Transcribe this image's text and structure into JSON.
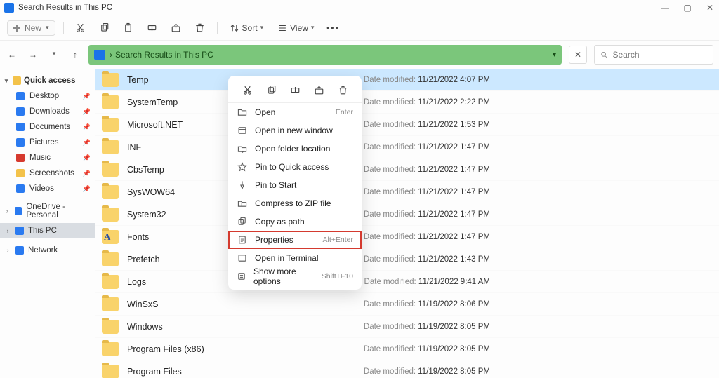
{
  "window": {
    "title": "Search Results in This PC"
  },
  "toolbar": {
    "new_label": "New",
    "sort_label": "Sort",
    "view_label": "View"
  },
  "addressbar": {
    "text": "Search Results in This PC"
  },
  "search": {
    "placeholder": "Search"
  },
  "sidebar": {
    "quick_access": "Quick access",
    "pinned": [
      {
        "label": "Desktop"
      },
      {
        "label": "Downloads"
      },
      {
        "label": "Documents"
      },
      {
        "label": "Pictures"
      },
      {
        "label": "Music"
      },
      {
        "label": "Screenshots"
      },
      {
        "label": "Videos"
      }
    ],
    "onedrive": "OneDrive - Personal",
    "this_pc": "This PC",
    "network": "Network"
  },
  "meta_label": "Date modified:",
  "results": [
    {
      "name": "Temp",
      "date": "11/21/2022 4:07 PM",
      "selected": true
    },
    {
      "name": "SystemTemp",
      "date": "11/21/2022 2:22 PM"
    },
    {
      "name": "Microsoft.NET",
      "date": "11/21/2022 1:53 PM"
    },
    {
      "name": "INF",
      "date": "11/21/2022 1:47 PM"
    },
    {
      "name": "CbsTemp",
      "date": "11/21/2022 1:47 PM"
    },
    {
      "name": "SysWOW64",
      "date": "11/21/2022 1:47 PM"
    },
    {
      "name": "System32",
      "date": "11/21/2022 1:47 PM"
    },
    {
      "name": "Fonts",
      "date": "11/21/2022 1:47 PM",
      "fonts": true
    },
    {
      "name": "Prefetch",
      "date": "11/21/2022 1:43 PM"
    },
    {
      "name": "Logs",
      "date": "11/21/2022 9:41 AM"
    },
    {
      "name": "WinSxS",
      "date": "11/19/2022 8:06 PM"
    },
    {
      "name": "Windows",
      "date": "11/19/2022 8:05 PM"
    },
    {
      "name": "Program Files (x86)",
      "date": "11/19/2022 8:05 PM"
    },
    {
      "name": "Program Files",
      "date": "11/19/2022 8:05 PM"
    }
  ],
  "context_menu": {
    "items": [
      {
        "label": "Open",
        "shortcut": "Enter",
        "icon": "folder"
      },
      {
        "label": "Open in new window",
        "icon": "window"
      },
      {
        "label": "Open folder location",
        "icon": "location"
      },
      {
        "label": "Pin to Quick access",
        "icon": "star"
      },
      {
        "label": "Pin to Start",
        "icon": "pin"
      },
      {
        "label": "Compress to ZIP file",
        "icon": "zip"
      },
      {
        "label": "Copy as path",
        "icon": "path"
      },
      {
        "label": "Properties",
        "shortcut": "Alt+Enter",
        "icon": "props",
        "highlight": true
      },
      {
        "label": "Open in Terminal",
        "icon": "terminal"
      },
      {
        "label": "Show more options",
        "shortcut": "Shift+F10",
        "icon": "more"
      }
    ]
  }
}
